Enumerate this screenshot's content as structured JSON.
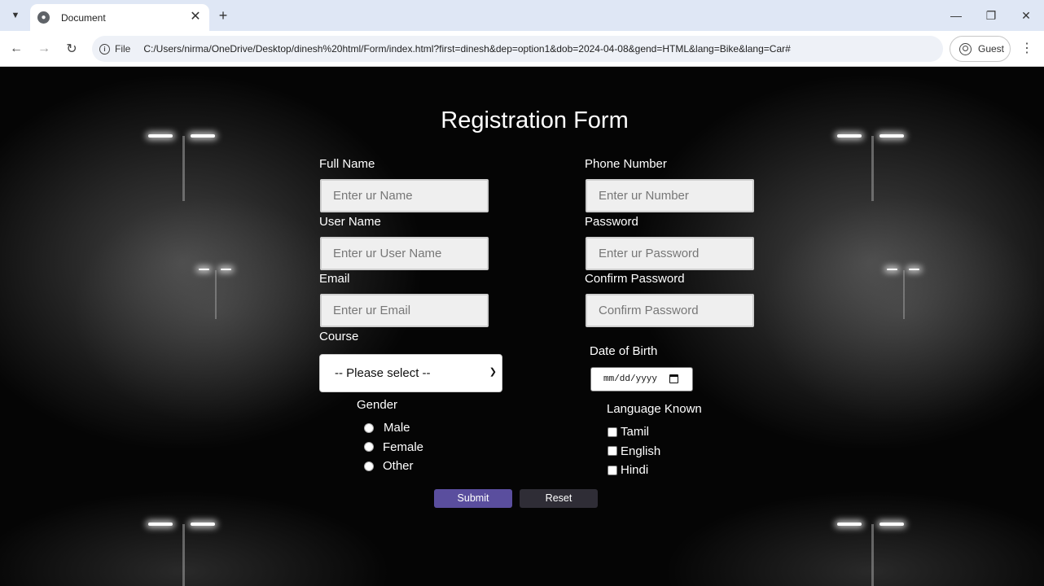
{
  "browser": {
    "tab_title": "Document",
    "new_tab": "+",
    "file_chip": "File",
    "url": "C:/Users/nirma/OneDrive/Desktop/dinesh%20html/Form/index.html?first=dinesh&dep=option1&dob=2024-04-08&gend=HTML&lang=Bike&lang=Car#",
    "profile_label": "Guest"
  },
  "form": {
    "title": "Registration Form",
    "full_name": {
      "label": "Full Name",
      "placeholder": "Enter ur Name"
    },
    "user_name": {
      "label": "User Name",
      "placeholder": "Enter ur User Name"
    },
    "email": {
      "label": "Email",
      "placeholder": "Enter ur Email"
    },
    "phone": {
      "label": "Phone Number",
      "placeholder": "Enter ur Number"
    },
    "password": {
      "label": "Password",
      "placeholder": "Enter ur Password"
    },
    "confirm_password": {
      "label": "Confirm Password",
      "placeholder": "Confirm Password"
    },
    "course": {
      "label": "Course",
      "selected": "-- Please select --"
    },
    "dob": {
      "label": "Date of Birth",
      "value": "mm/dd/yyyy"
    },
    "gender": {
      "label": "Gender",
      "options": [
        "Male",
        "Female",
        "Other"
      ]
    },
    "languages": {
      "label": "Language Known",
      "options": [
        "Tamil",
        "English",
        "Hindi"
      ]
    },
    "submit_label": "Submit",
    "reset_label": "Reset"
  },
  "colors": {
    "submit": "#5a4e9e",
    "reset": "#2f2d36",
    "tabbar": "#dfe7f5"
  }
}
